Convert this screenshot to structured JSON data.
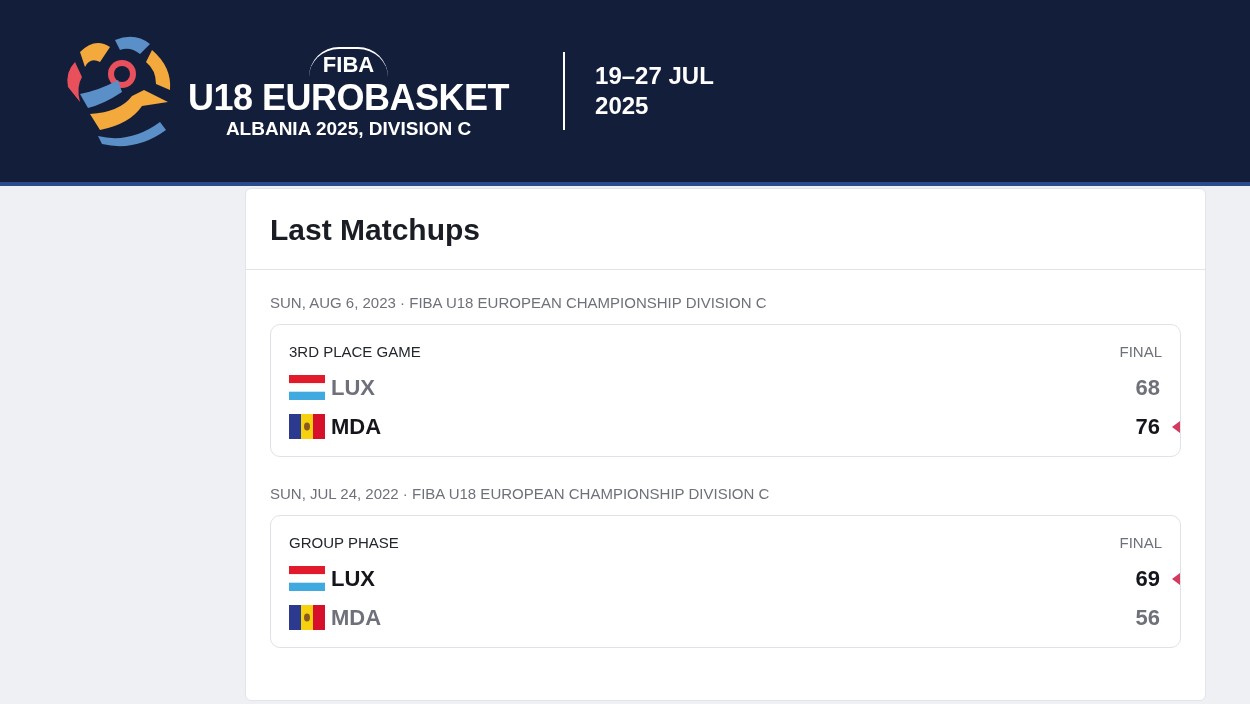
{
  "header": {
    "brand": "FIBA",
    "title": "U18 EUROBASKET",
    "subtitle": "ALBANIA 2025, DIVISION C",
    "dates": "19–27 JUL",
    "year": "2025"
  },
  "section": {
    "title": "Last Matchups"
  },
  "matchups": [
    {
      "date_line": "SUN, AUG 6, 2023 · FIBA U18 EUROPEAN CHAMPIONSHIP DIVISION C",
      "round": "3RD PLACE GAME",
      "status": "FINAL",
      "teams": [
        {
          "code": "LUX",
          "kind": "lux",
          "score": "68",
          "winner": false
        },
        {
          "code": "MDA",
          "kind": "mda",
          "score": "76",
          "winner": true
        }
      ]
    },
    {
      "date_line": "SUN, JUL 24, 2022 · FIBA U18 EUROPEAN CHAMPIONSHIP DIVISION C",
      "round": "GROUP PHASE",
      "status": "FINAL",
      "teams": [
        {
          "code": "LUX",
          "kind": "lux",
          "score": "69",
          "winner": true
        },
        {
          "code": "MDA",
          "kind": "mda",
          "score": "56",
          "winner": false
        }
      ]
    }
  ]
}
